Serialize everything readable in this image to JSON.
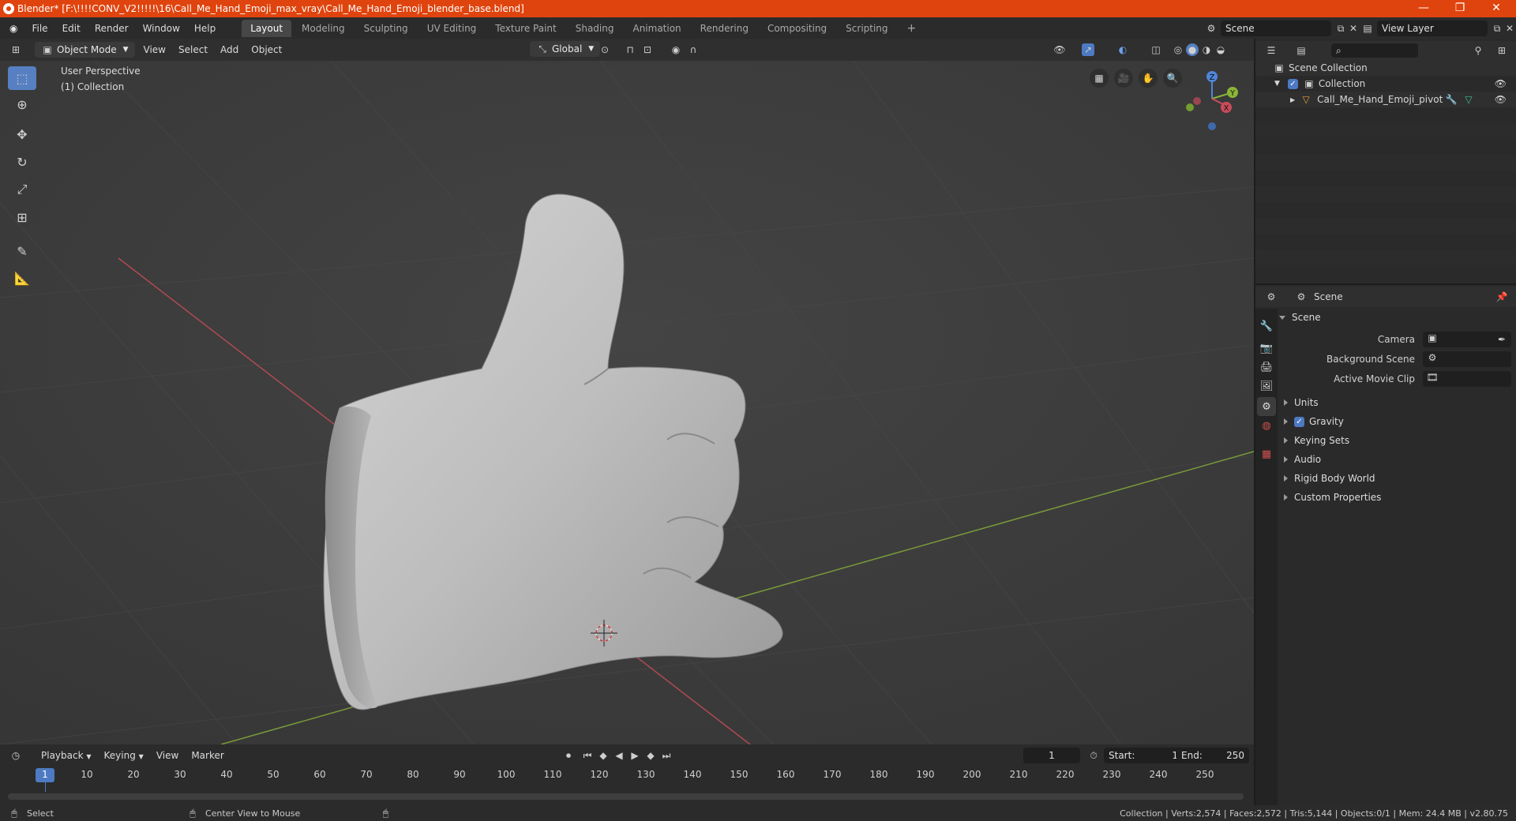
{
  "window": {
    "title": "Blender* [F:\\!!!!CONV_V2!!!!!\\16\\Call_Me_Hand_Emoji_max_vray\\Call_Me_Hand_Emoji_blender_base.blend]",
    "minimize": "—",
    "maximize": "❐",
    "close": "✕"
  },
  "menu": {
    "items": [
      "File",
      "Edit",
      "Render",
      "Window",
      "Help"
    ],
    "workspaces": [
      "Layout",
      "Modeling",
      "Sculpting",
      "UV Editing",
      "Texture Paint",
      "Shading",
      "Animation",
      "Rendering",
      "Compositing",
      "Scripting"
    ],
    "add_workspace": "+",
    "scene_label": "Scene",
    "view_layer_label": "View Layer"
  },
  "viewport_header": {
    "mode": "Object Mode",
    "view": "View",
    "select": "Select",
    "add": "Add",
    "object": "Object",
    "orientation": "Global"
  },
  "viewport": {
    "perspective_label": "User Perspective",
    "collection_label": "(1) Collection",
    "gizmo": {
      "z": "Z",
      "y": "Y",
      "x": "X"
    }
  },
  "outliner": {
    "scene_collection": "Scene Collection",
    "collection": "Collection",
    "object": "Call_Me_Hand_Emoji_pivot"
  },
  "properties": {
    "header": "Scene",
    "section": "Scene",
    "camera_label": "Camera",
    "background_scene_label": "Background Scene",
    "active_movie_clip_label": "Active Movie Clip",
    "subsections": [
      "Units",
      "Gravity",
      "Keying Sets",
      "Audio",
      "Rigid Body World",
      "Custom Properties"
    ],
    "gravity_checked": true
  },
  "timeline": {
    "playback": "Playback",
    "keying": "Keying",
    "view": "View",
    "marker": "Marker",
    "current_frame": "1",
    "start_label": "Start:",
    "start_value": "1",
    "end_label": "End:",
    "end_value": "250",
    "ticks": [
      "1",
      "10",
      "20",
      "30",
      "40",
      "50",
      "60",
      "70",
      "80",
      "90",
      "100",
      "110",
      "120",
      "130",
      "140",
      "150",
      "160",
      "170",
      "180",
      "190",
      "200",
      "210",
      "220",
      "230",
      "240",
      "250"
    ]
  },
  "status": {
    "select": "Select",
    "center_view": "Center View to Mouse",
    "stats": "Collection | Verts:2,574 | Faces:2,572 | Tris:5,144 | Objects:0/1 | Mem: 24.4 MB | v2.80.75"
  },
  "colors": {
    "accent": "#e0440e",
    "active_blue": "#5680c2",
    "x_axis": "#c94c5a",
    "y_axis": "#8ab537",
    "z_axis": "#4f86d9"
  }
}
